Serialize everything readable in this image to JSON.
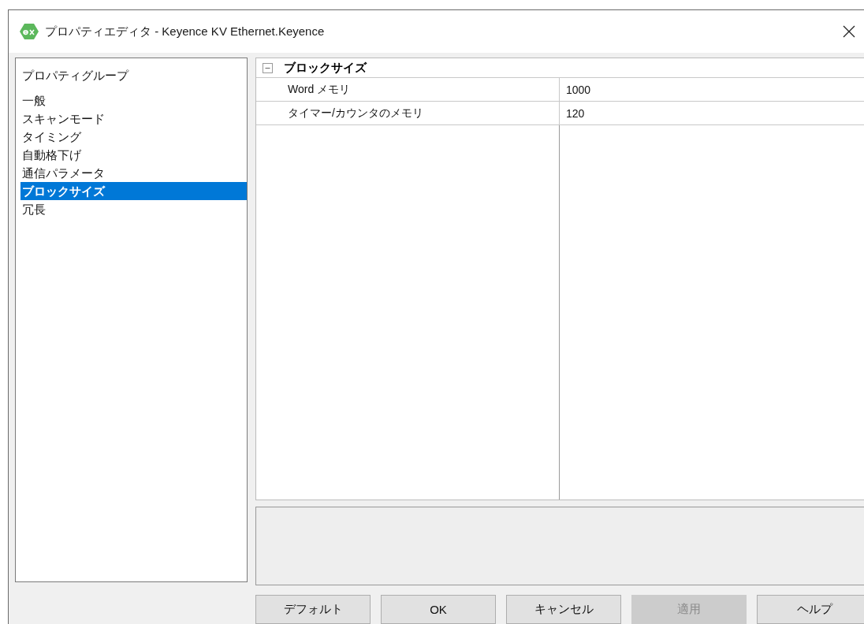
{
  "window": {
    "title": "プロパティエディタ - Keyence KV Ethernet.Keyence"
  },
  "property_groups": {
    "heading": "プロパティグループ",
    "items": [
      {
        "label": "一般",
        "selected": false
      },
      {
        "label": "スキャンモード",
        "selected": false
      },
      {
        "label": "タイミング",
        "selected": false
      },
      {
        "label": "自動格下げ",
        "selected": false
      },
      {
        "label": "通信パラメータ",
        "selected": false
      },
      {
        "label": "ブロックサイズ",
        "selected": true
      },
      {
        "label": "冗長",
        "selected": false
      }
    ]
  },
  "property_grid": {
    "category": {
      "label": "ブロックサイズ",
      "expanded": true
    },
    "rows": [
      {
        "name": "Word メモリ",
        "value": "1000"
      },
      {
        "name": "タイマー/カウンタのメモリ",
        "value": "120"
      }
    ]
  },
  "buttons": [
    {
      "label": "デフォルト",
      "disabled": false
    },
    {
      "label": "OK",
      "disabled": false
    },
    {
      "label": "キャンセル",
      "disabled": false
    },
    {
      "label": "適用",
      "disabled": true
    },
    {
      "label": "ヘルプ",
      "disabled": false
    }
  ]
}
